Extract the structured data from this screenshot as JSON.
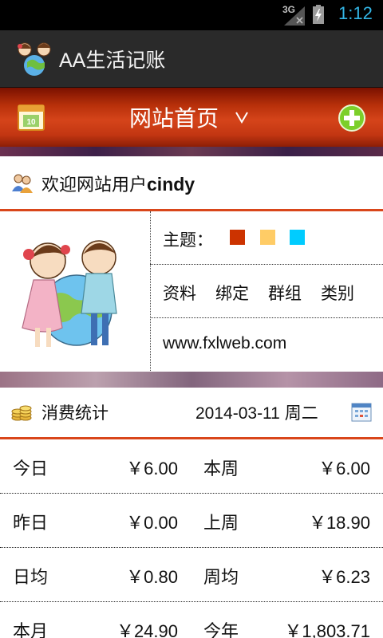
{
  "status_bar": {
    "network": "3G",
    "time": "1:12"
  },
  "app": {
    "title": "AA生活记账"
  },
  "header": {
    "title": "网站首页"
  },
  "welcome": {
    "prefix": "欢迎网站用户",
    "username": "cindy"
  },
  "profile": {
    "theme_label": "主题：",
    "theme_colors": [
      "#cc3300",
      "#ffcc66",
      "#00ccff"
    ],
    "links": [
      "资料",
      "绑定",
      "群组",
      "类别"
    ],
    "website": "www.fxlweb.com"
  },
  "stats": {
    "title": "消费统计",
    "date": "2014-03-11 周二",
    "rows": [
      {
        "l1": "今日",
        "v1": "￥6.00",
        "l2": "本周",
        "v2": "￥6.00"
      },
      {
        "l1": "昨日",
        "v1": "￥0.00",
        "l2": "上周",
        "v2": "￥18.90"
      },
      {
        "l1": "日均",
        "v1": "￥0.80",
        "l2": "周均",
        "v2": "￥6.23"
      },
      {
        "l1": "本月",
        "v1": "￥24.90",
        "l2": "今年",
        "v2": "￥1,803.71"
      }
    ]
  }
}
